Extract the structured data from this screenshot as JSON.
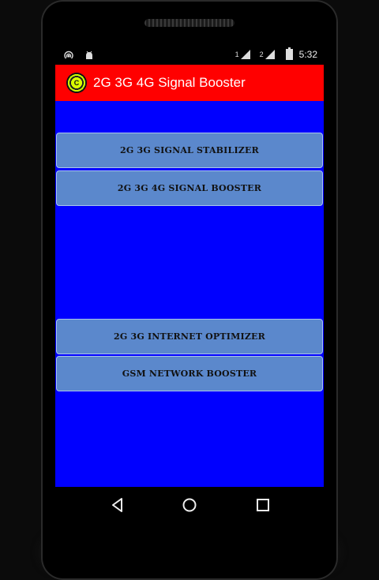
{
  "status_bar": {
    "left_icons": [
      "radio-icon",
      "android-debug-icon"
    ],
    "sim1_label": "1",
    "sim2_label": "2",
    "time": "5:32"
  },
  "app_bar": {
    "title": "2G 3G 4G Signal Booster",
    "icon_letter": "C"
  },
  "buttons": [
    {
      "label": "2G 3G SIGNAL STABILIZER"
    },
    {
      "label": "2G 3G 4G SIGNAL BOOSTER"
    },
    {
      "label": "2G 3G INTERNET OPTIMIZER"
    },
    {
      "label": "GSM NETWORK BOOSTER"
    }
  ],
  "nav_bar": {
    "icons": [
      "back-icon",
      "home-icon",
      "recents-icon"
    ]
  },
  "colors": {
    "app_bar": "#ff0000",
    "content_background": "#0000ff",
    "button_fill": "#5b88cc"
  }
}
